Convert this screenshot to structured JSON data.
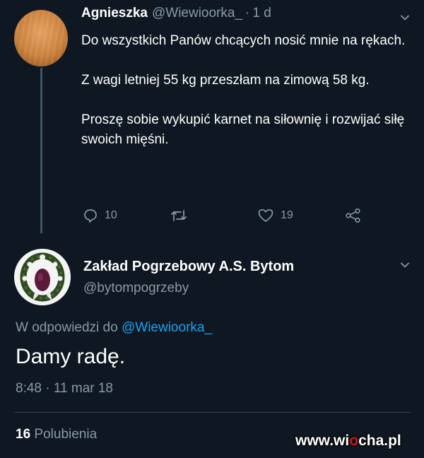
{
  "tweet": {
    "author_name": "Agnieszka",
    "handle": "@Wiewioorka_",
    "separator": "·",
    "time": "1 d",
    "paragraphs": [
      "Do wszystkich Panów chcących nosić mnie na rękach.",
      "Z wagi letniej 55 kg przeszłam na zimową 58 kg.",
      "Proszę sobie wykupić karnet na siłownię i rozwijać siłę swoich mięśni."
    ],
    "actions": {
      "reply_count": "10",
      "retweet_count": "",
      "like_count": "19"
    }
  },
  "reply": {
    "author_name": "Zakład Pogrzebowy A.S. Bytom",
    "handle": "@bytompogrzeby",
    "in_reply_prefix": "W odpowiedzi do",
    "in_reply_mention": "@Wiewioorka_",
    "text": "Damy radę.",
    "timestamp": "8:48 · 11 mar 18",
    "likes_count": "16",
    "likes_label": "Polubienia"
  },
  "watermark": {
    "part1": "www.wi",
    "part2": "o",
    "part3": "cha.pl"
  },
  "colors": {
    "background": "#0f1822",
    "secondary_text": "#8899a6",
    "link": "#1da1f2"
  }
}
